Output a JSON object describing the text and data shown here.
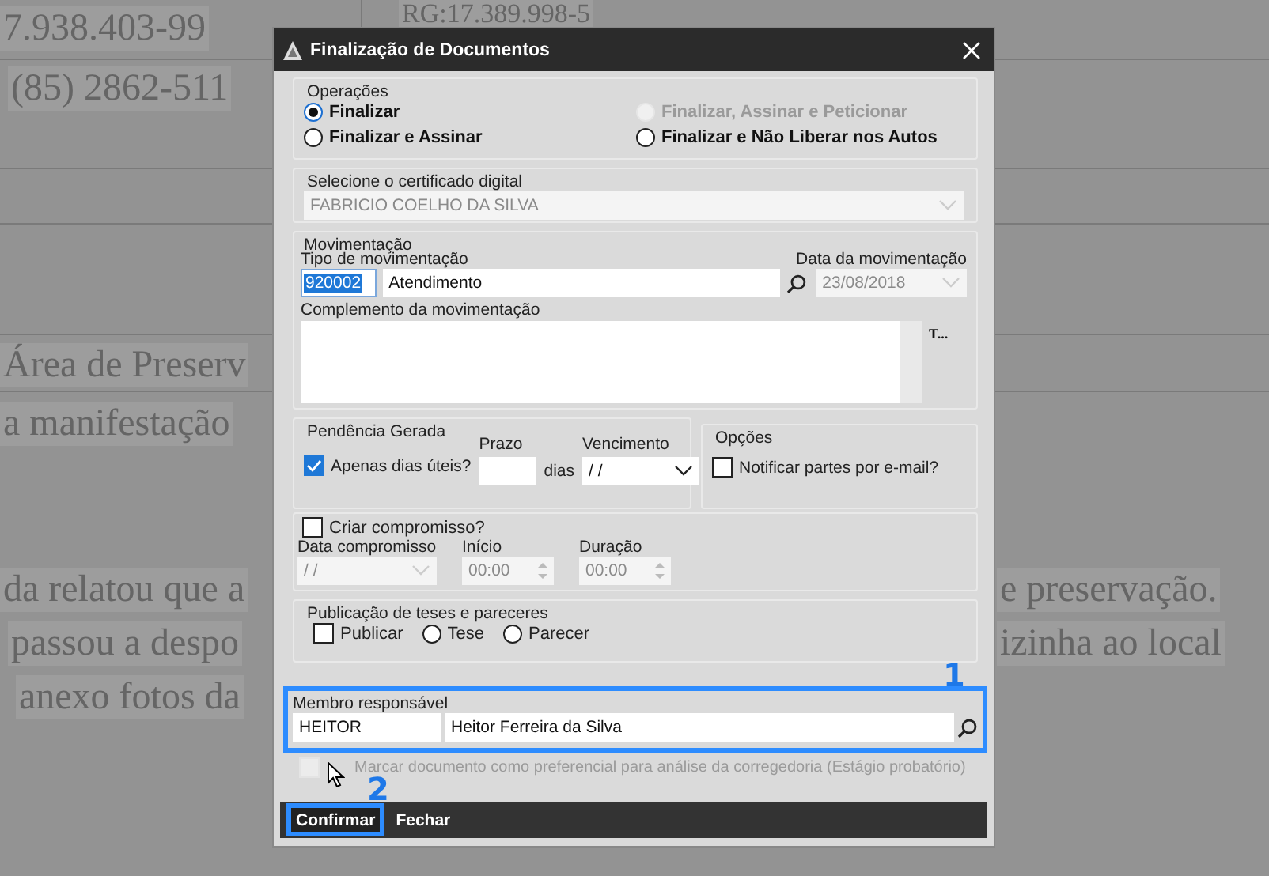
{
  "background_document": {
    "texts": [
      {
        "text": "7.938.403-99"
      },
      {
        "text": "RG:17.389.998-5"
      },
      {
        "text": "(85) 2862-511"
      },
      {
        "text": "Área de Preserv"
      },
      {
        "text": "a manifestação"
      },
      {
        "text": "da relatou que a"
      },
      {
        "text": "e preservação."
      },
      {
        "text": "passou a despo"
      },
      {
        "text": "izinha ao local"
      },
      {
        "text": "anexo fotos da"
      }
    ]
  },
  "dialog": {
    "title": "Finalização de Documentos",
    "operacoes": {
      "title": "Operações",
      "options": [
        {
          "label": "Finalizar",
          "selected": true,
          "disabled": false
        },
        {
          "label": "Finalizar, Assinar e Peticionar",
          "selected": false,
          "disabled": true
        },
        {
          "label": "Finalizar e Assinar",
          "selected": false,
          "disabled": false
        },
        {
          "label": "Finalizar e Não Liberar nos Autos",
          "selected": false,
          "disabled": false
        }
      ]
    },
    "certificado": {
      "title": "Selecione o certificado digital",
      "value": "FABRICIO COELHO DA SILVA"
    },
    "movimentacao": {
      "title": "Movimentação",
      "tipo_label": "Tipo de movimentação",
      "code": "920002",
      "description": "Atendimento",
      "data_label": "Data da movimentação",
      "data_value": "23/08/2018",
      "complemento_label": "Complemento da movimentação",
      "side_text": "T..."
    },
    "pendencia": {
      "title": "Pendência Gerada",
      "apenas_label": "Apenas dias úteis?",
      "apenas_checked": true,
      "prazo_label": "Prazo",
      "dias": "dias",
      "vencimento_label": "Vencimento",
      "vencimento_value": "/ /"
    },
    "opcoes": {
      "title": "Opções",
      "notificar_label": "Notificar partes por e-mail?",
      "notificar_checked": false
    },
    "compromisso": {
      "label": "Criar compromisso?",
      "checked": false,
      "data_label": "Data compromisso",
      "data_value": "/ /",
      "inicio_label": "Início",
      "inicio_value": "00:00",
      "duracao_label": "Duração",
      "duracao_value": "00:00"
    },
    "publicacao": {
      "title": "Publicação de teses e pareceres",
      "publicar_label": "Publicar",
      "publicar_checked": false,
      "options": [
        {
          "label": "Tese",
          "selected": false
        },
        {
          "label": "Parecer",
          "selected": false
        }
      ]
    },
    "membro": {
      "label": "Membro responsável",
      "code": "HEITOR",
      "name": "Heitor Ferreira da Silva",
      "highlighted": true
    },
    "marcar": {
      "label": "Marcar documento como preferencial para análise da corregedoria (Estágio probatório)",
      "checked": false
    },
    "buttons": [
      {
        "label": "Confirmar",
        "highlighted": true
      },
      {
        "label": "Fechar",
        "highlighted": false
      }
    ]
  },
  "annotations": [
    {
      "label": "1"
    },
    {
      "label": "2"
    }
  ]
}
